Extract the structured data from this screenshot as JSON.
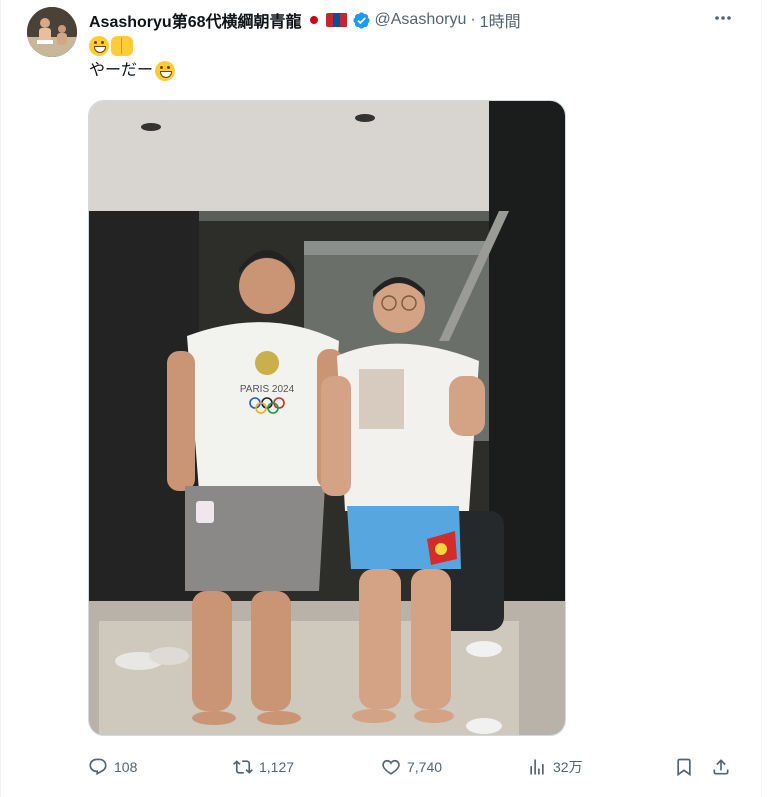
{
  "tweet": {
    "display_name": "Asashoryu第68代横綱朝青龍",
    "handle": "@Asashoryu",
    "separator": "·",
    "time": "1時間",
    "text_line2": "やーだー",
    "photo_text": "PARIS 2024",
    "more_icon": "more-dots-icon"
  },
  "actions": {
    "reply_count": "108",
    "retweet_count": "1,127",
    "like_count": "7,740",
    "views_count": "32万"
  },
  "colors": {
    "text_primary": "#0f1419",
    "text_secondary": "#536471",
    "verified_blue": "#1d9bf0",
    "border": "#eff3f4"
  }
}
